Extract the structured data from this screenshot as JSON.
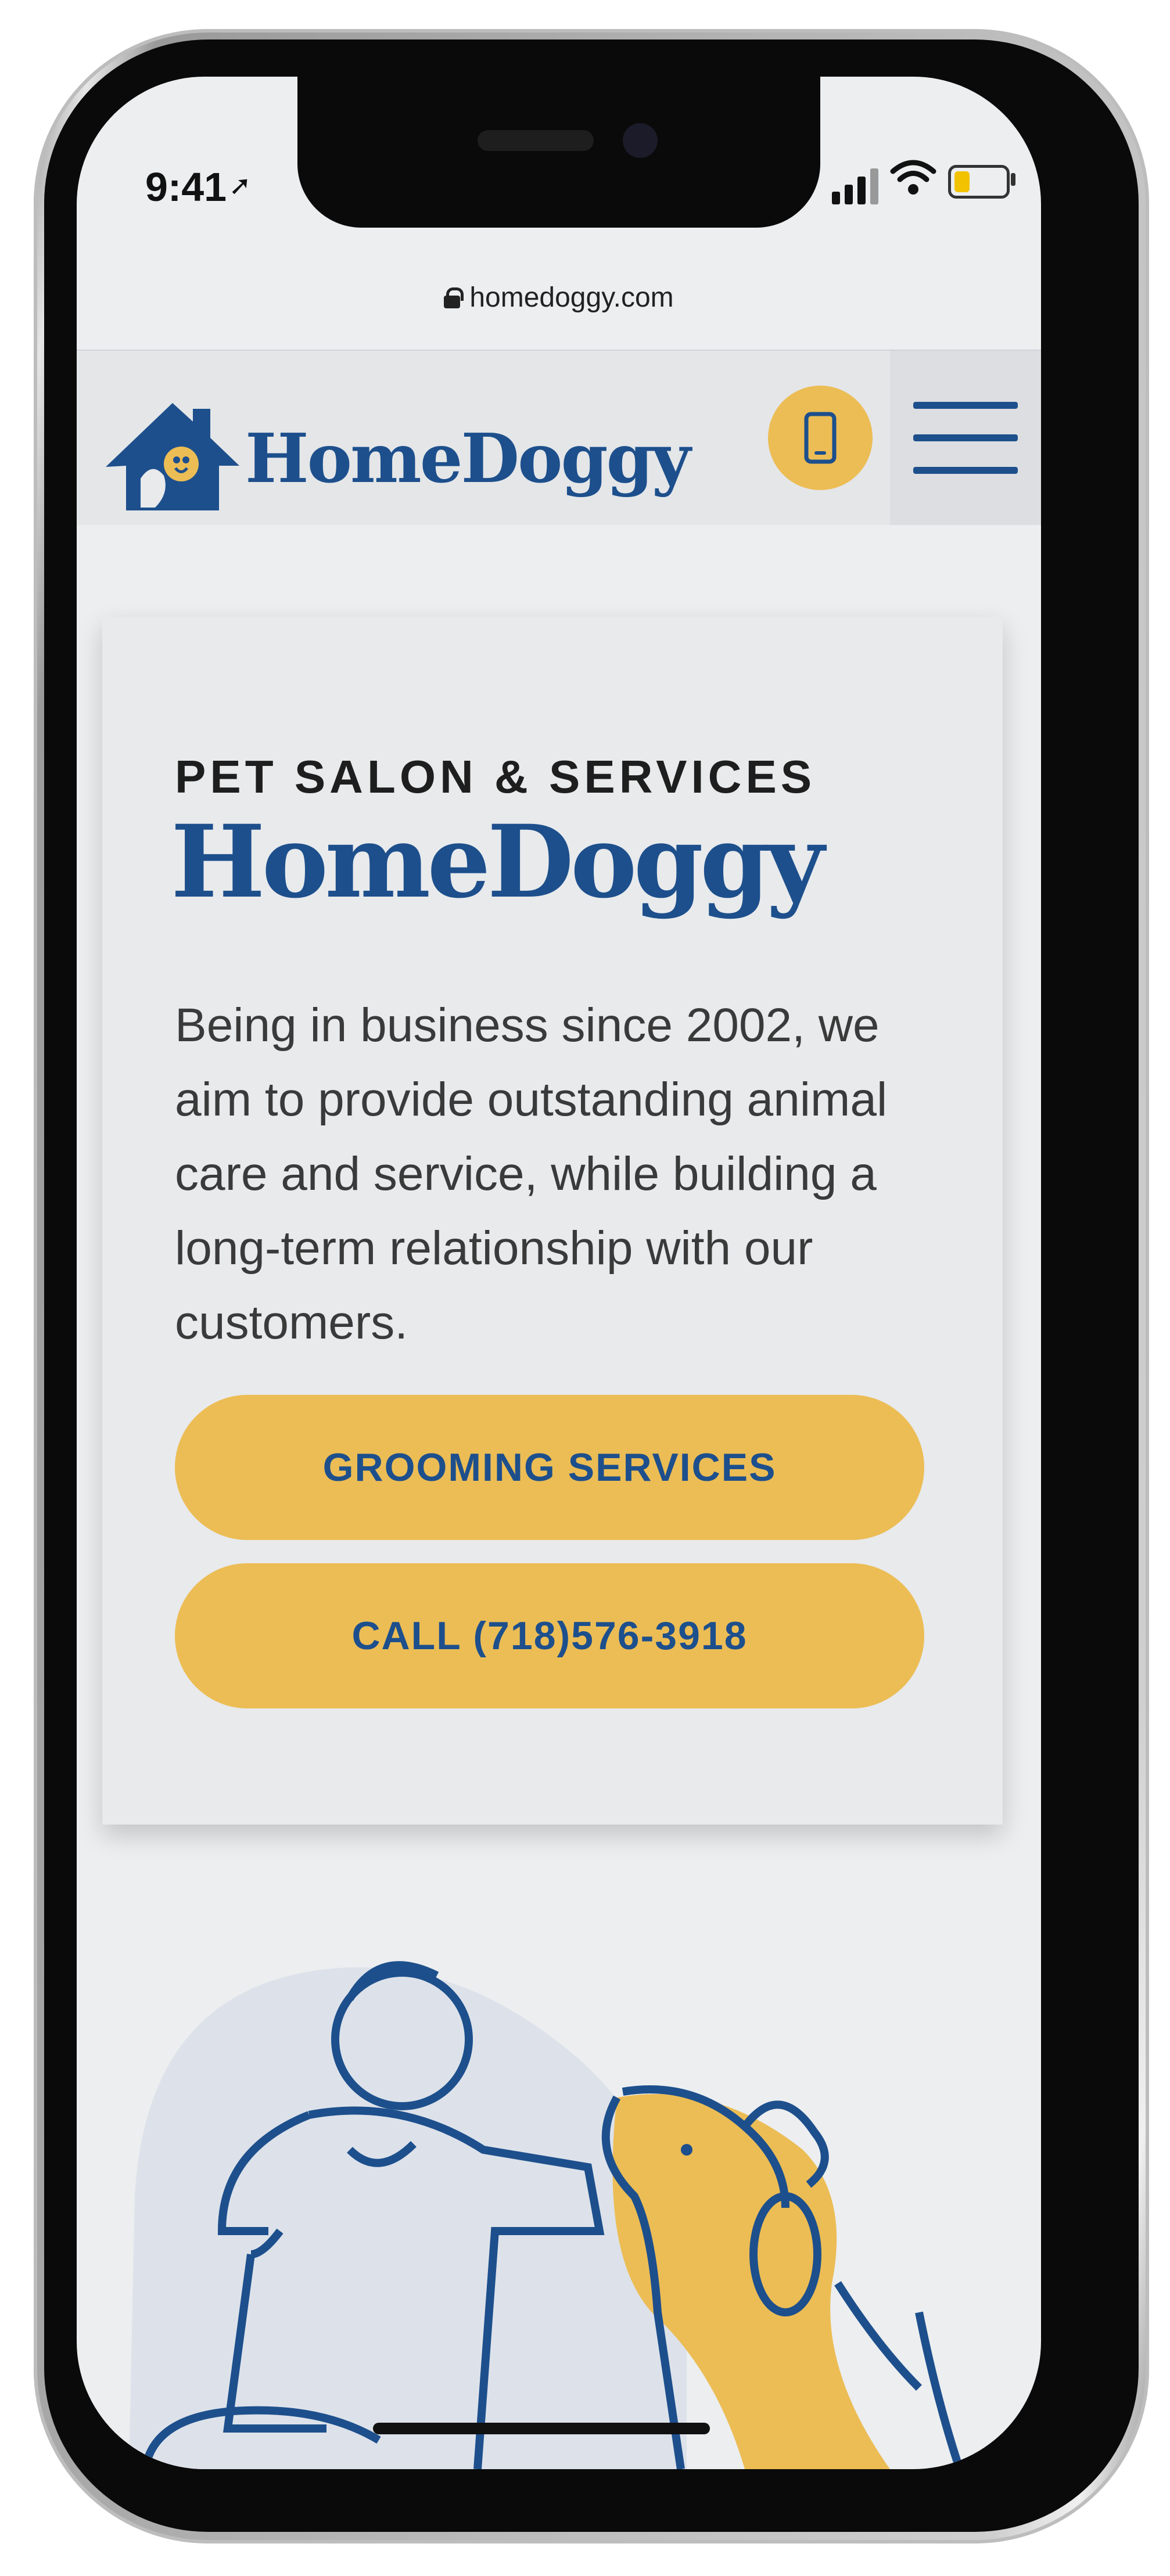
{
  "status_bar": {
    "time": "9:41"
  },
  "browser": {
    "url": "homedoggy.com"
  },
  "header": {
    "logo_text": "HomeDoggy"
  },
  "hero": {
    "eyebrow": "PET SALON & SERVICES",
    "title": "HomeDoggy",
    "body": "Being in business since 2002, we aim to provide outstanding animal care and service, while building a long-term relationship with our customers.",
    "buttons": {
      "grooming": "GROOMING SERVICES",
      "call": "CALL (718)576-3918"
    }
  },
  "icons": [
    "location-arrow-icon",
    "cellular-signal-icon",
    "wifi-icon",
    "battery-icon",
    "lock-icon",
    "house-dog-logo-icon",
    "phone-icon",
    "hamburger-menu-icon"
  ],
  "colors": {
    "brand_blue": "#1d4f8c",
    "accent_yellow": "#ecbd55",
    "page_background": "#eceef0",
    "card_background": "#e8eaec"
  }
}
